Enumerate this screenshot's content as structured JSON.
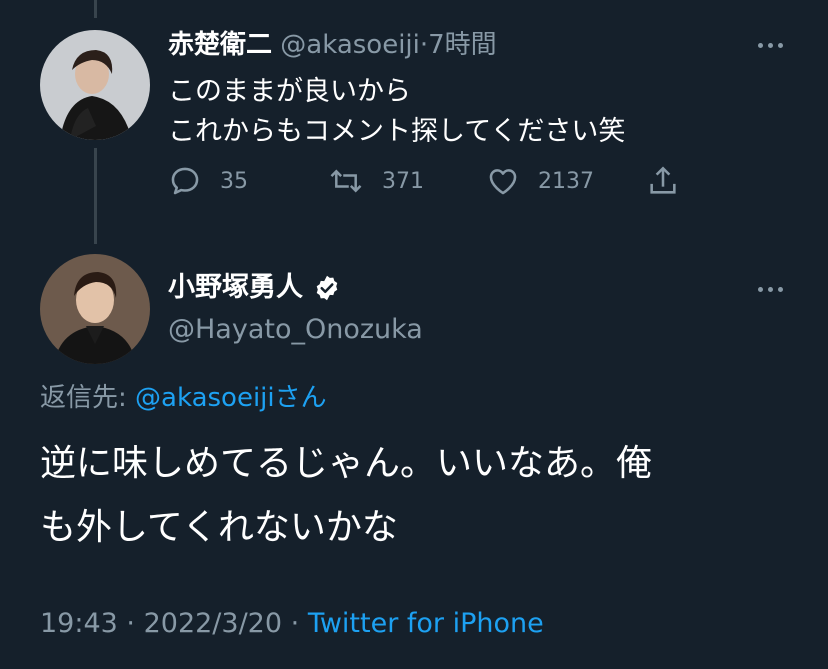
{
  "reply_tweet": {
    "author_name": "赤楚衛二",
    "author_handle": "@akasoeiji",
    "separator": "·",
    "time_ago": "7時間",
    "text_lines": [
      "このままが良いから",
      "これからもコメント探してください笑"
    ],
    "reply_count": "35",
    "retweet_count": "371",
    "like_count": "2137",
    "icons": [
      "reply-icon",
      "retweet-icon",
      "like-icon",
      "share-icon",
      "more-icon"
    ]
  },
  "main_tweet": {
    "author_name": "小野塚勇人",
    "verified": true,
    "author_handle": "@Hayato_Onozuka",
    "reply_to_prefix": "返信先:",
    "reply_to_handle": "@akasoeiji",
    "reply_to_suffix": "さん",
    "text_lines": [
      "逆に味しめてるじゃん。いいなあ。俺",
      "も外してくれないかな"
    ],
    "time": "19:43",
    "separator": "·",
    "date": "2022/3/20",
    "client": "Twitter for iPhone"
  },
  "colors": {
    "background": "#15202b",
    "text": "#ffffff",
    "muted": "#8899a6",
    "link": "#1da1f2",
    "divider": "#38444d"
  }
}
